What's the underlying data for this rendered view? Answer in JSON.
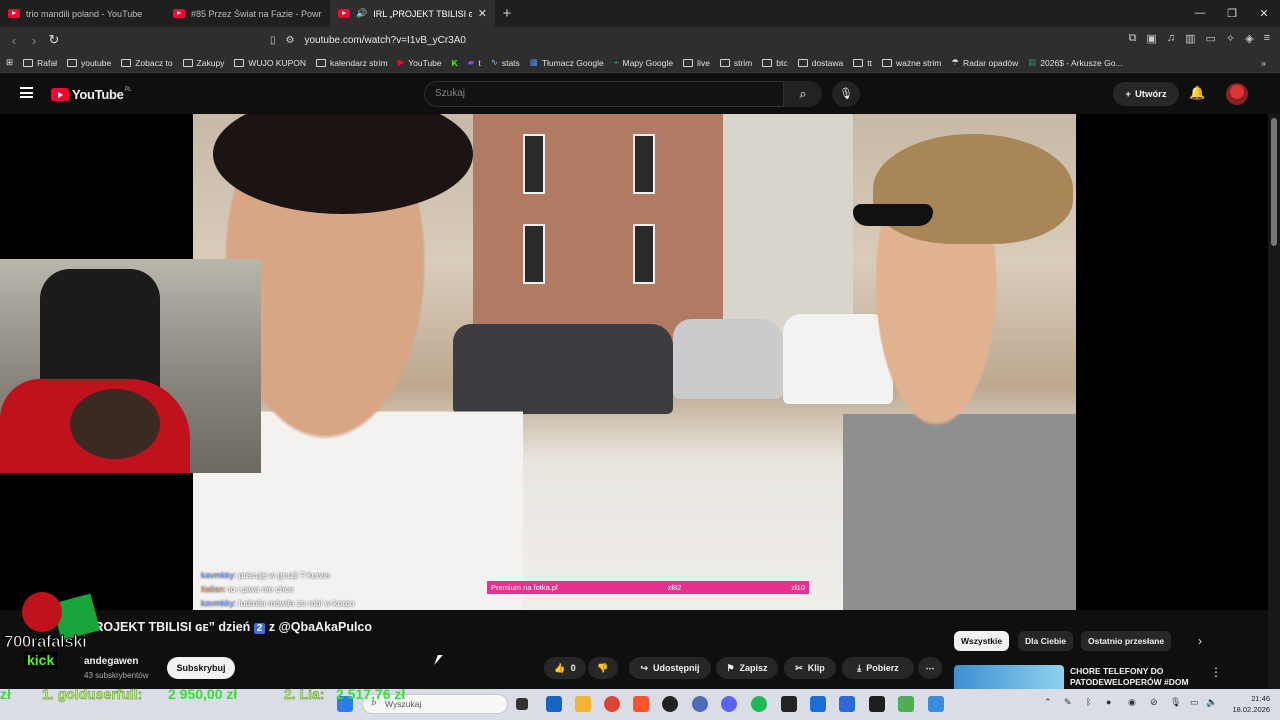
{
  "browser": {
    "tabs": [
      {
        "title": "trio mandili poland - YouTube",
        "active": false
      },
      {
        "title": "#85 Przez Świat na Fazie - Powrót - Gr",
        "active": false
      },
      {
        "title": "IRL „PROJEKT TBILISI ɢᴇ” dzień",
        "active": true
      }
    ],
    "new_tab": "+",
    "window_controls": [
      "—",
      "❐",
      "✕"
    ],
    "url": "youtube.com/watch?v=I1vB_yCr3A0",
    "bookmarks": [
      "Rafał",
      "youtube",
      "Zobacz to",
      "Zakupy",
      "WUJO KUPON",
      "kalendarz strim",
      "YouTube",
      "t",
      "stats",
      "Tłumacz Google",
      "Mapy Google",
      "live",
      "strim",
      "btc",
      "dostawa",
      "tt",
      "ważne strim",
      "Radar opadów",
      "2026$ - Arkusze Go..."
    ],
    "bookmarks_more": "»"
  },
  "youtube": {
    "logo_text": "YouTube",
    "logo_region": "PL",
    "search_placeholder": "Szukaj",
    "create_label": "Utwórz",
    "video_title_prefix": "PROJEKT TBILISI ɢᴇ” dzień",
    "video_title_num": "2",
    "video_title_suffix": "z @QbaAkaPulco",
    "channel_name": "andegawen",
    "subscribers": "43 subskrybentów",
    "subscribe_label": "Subskrybuj",
    "likes": "0",
    "actions": {
      "share": "Udostępnij",
      "save": "Zapisz",
      "clip": "Klip",
      "download": "Pobierz",
      "more": "⋯"
    },
    "chips": [
      "Wszystkie",
      "Dla Ciebie",
      "Ostatnio przesłane"
    ],
    "recommended_title": "CHORE TELEFONY DO PATODEWELOPERÓW #DOM"
  },
  "stream_overlay": {
    "chat": [
      {
        "user": "kavmkky:",
        "text": "pracuję w gruzji ? kurwa",
        "alt": false
      },
      {
        "user": "Italian:",
        "text": "to i piwa nie chce",
        "alt": true
      },
      {
        "user": "kavmkky:",
        "text": "ludmila mówiła że robi w korpo",
        "alt": false
      }
    ],
    "donation": {
      "label": "Premium na fotka.pl",
      "price": "zł82",
      "goal": "zł10"
    },
    "streamer_logo": "700rafalski",
    "kick_label": "kick",
    "leaderboard": [
      {
        "rank_name": "1. golduserfull:",
        "amount": "2 950,00 zł"
      },
      {
        "rank_name": "2. Lia:",
        "amount": "2 517,76 zł"
      }
    ]
  },
  "taskbar": {
    "search_placeholder": "Wyszukaj",
    "time": "21:46",
    "date": "18.02.2026"
  }
}
